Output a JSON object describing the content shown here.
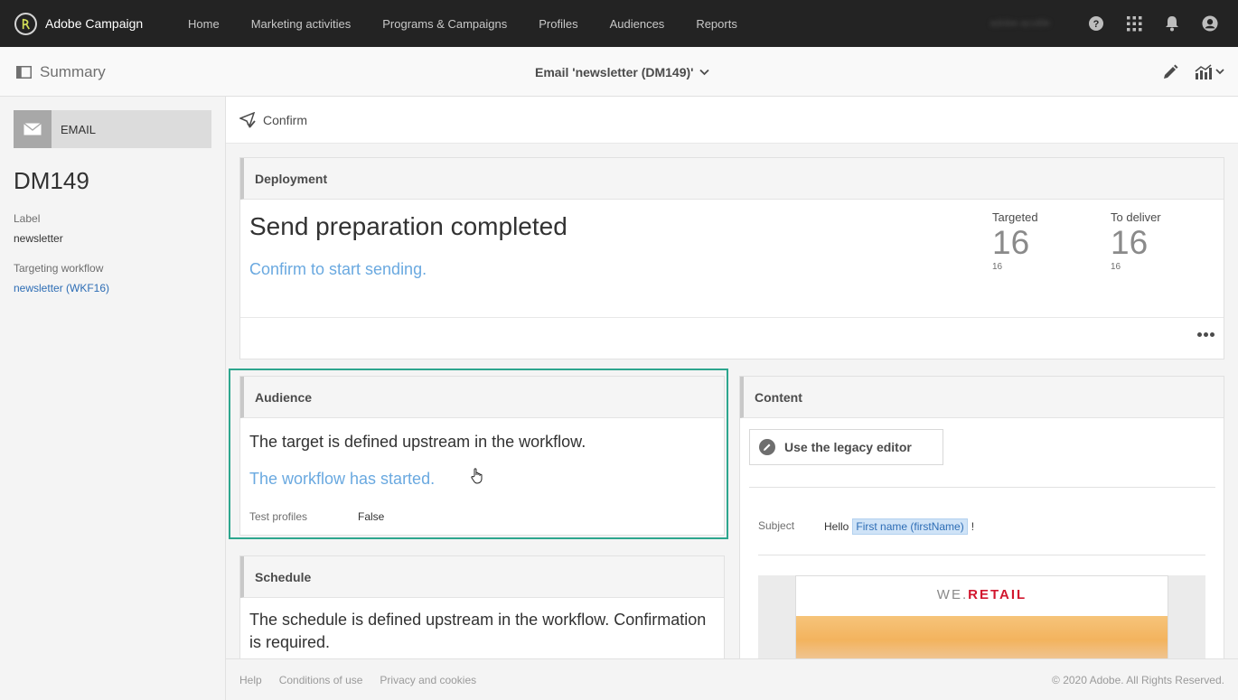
{
  "topnav": {
    "brand": "Adobe Campaign",
    "links": [
      "Home",
      "Marketing activities",
      "Programs & Campaigns",
      "Profiles",
      "Audiences",
      "Reports"
    ],
    "username": "adobe-acuttle",
    "icons": [
      "help-icon",
      "apps-grid-icon",
      "notification-bell-icon",
      "user-avatar-icon"
    ]
  },
  "header": {
    "summary_label": "Summary",
    "title": "Email 'newsletter (DM149)'"
  },
  "sidebar": {
    "badge": "EMAIL",
    "code": "DM149",
    "label_title": "Label",
    "label_value": "newsletter",
    "workflow_title": "Targeting workflow",
    "workflow_link": "newsletter (WKF16)"
  },
  "actionbar": {
    "confirm": "Confirm"
  },
  "deployment": {
    "title": "Deployment",
    "status": "Send preparation completed",
    "link": "Confirm to start sending.",
    "targeted_label": "Targeted",
    "targeted_value": "16",
    "targeted_sub": "16",
    "todeliver_label": "To deliver",
    "todeliver_value": "16",
    "todeliver_sub": "16"
  },
  "audience": {
    "title": "Audience",
    "text": "The target is defined upstream in the workflow.",
    "link": "The workflow has started.",
    "test_label": "Test profiles",
    "test_value": "False"
  },
  "schedule": {
    "title": "Schedule",
    "text": "The schedule is defined upstream in the workflow. Confirmation is required."
  },
  "content": {
    "title": "Content",
    "legacy_button": "Use the legacy editor",
    "subject_label": "Subject",
    "subject_prefix": "Hello",
    "subject_tag": "First name (firstName)",
    "subject_suffix": "!",
    "logo_we": "WE.",
    "logo_retail": "RETAIL"
  },
  "footer": {
    "links": [
      "Help",
      "Conditions of use",
      "Privacy and cookies"
    ],
    "copyright": "© 2020 Adobe. All Rights Reserved."
  },
  "colors": {
    "topnav_bg": "#232323",
    "link_blue": "#6aa9e0",
    "highlight_border": "#2da68e",
    "retail_red": "#d2172e"
  }
}
